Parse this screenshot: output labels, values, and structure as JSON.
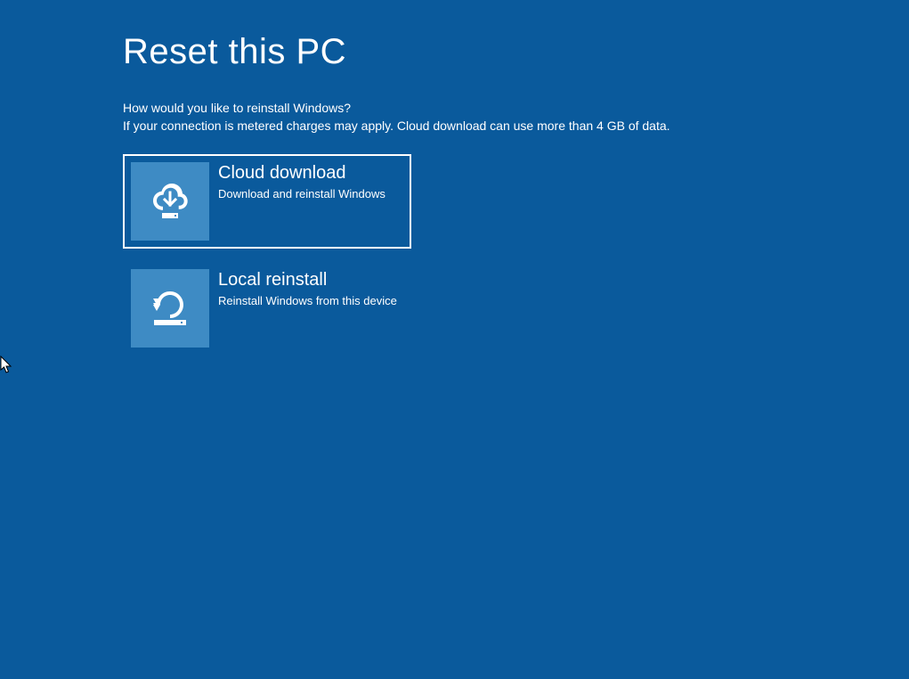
{
  "page": {
    "title": "Reset this PC",
    "subtitle1": "How would you like to reinstall Windows?",
    "subtitle2": "If your connection is metered charges may apply. Cloud download can use more than 4 GB of data."
  },
  "options": {
    "cloud": {
      "title": "Cloud download",
      "description": "Download and reinstall Windows"
    },
    "local": {
      "title": "Local reinstall",
      "description": "Reinstall Windows from this device"
    }
  }
}
